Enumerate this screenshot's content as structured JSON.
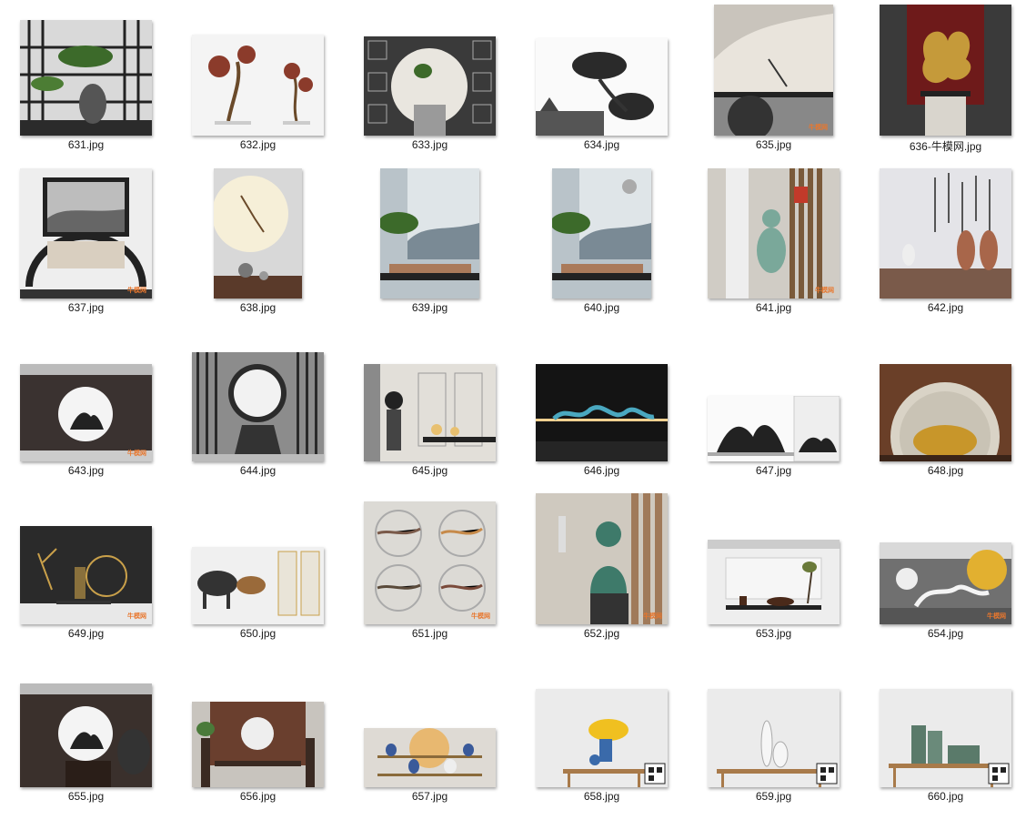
{
  "files": [
    {
      "name": "631.jpg"
    },
    {
      "name": "632.jpg"
    },
    {
      "name": "633.jpg"
    },
    {
      "name": "634.jpg"
    },
    {
      "name": "635.jpg"
    },
    {
      "name": "636-牛模网.jpg"
    },
    {
      "name": "637.jpg"
    },
    {
      "name": "638.jpg"
    },
    {
      "name": "639.jpg"
    },
    {
      "name": "640.jpg"
    },
    {
      "name": "641.jpg"
    },
    {
      "name": "642.jpg"
    },
    {
      "name": "643.jpg"
    },
    {
      "name": "644.jpg"
    },
    {
      "name": "645.jpg"
    },
    {
      "name": "646.jpg"
    },
    {
      "name": "647.jpg"
    },
    {
      "name": "648.jpg"
    },
    {
      "name": "649.jpg"
    },
    {
      "name": "650.jpg"
    },
    {
      "name": "651.jpg"
    },
    {
      "name": "652.jpg"
    },
    {
      "name": "653.jpg"
    },
    {
      "name": "654.jpg"
    },
    {
      "name": "655.jpg"
    },
    {
      "name": "656.jpg"
    },
    {
      "name": "657.jpg"
    },
    {
      "name": "658.jpg"
    },
    {
      "name": "659.jpg"
    },
    {
      "name": "660.jpg"
    }
  ],
  "watermark": "牛模网"
}
